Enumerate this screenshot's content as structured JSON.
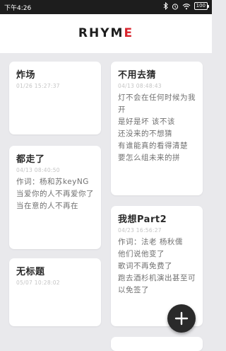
{
  "status_bar": {
    "time": "下午4:26",
    "battery": "100",
    "icons": [
      "bluetooth-icon",
      "alarm-icon",
      "wifi-icon",
      "battery-icon"
    ]
  },
  "app": {
    "title_main": "RHYM",
    "title_accent": "E",
    "accent_color": "#d9232d"
  },
  "notes": [
    {
      "title": "炸场",
      "time": "01/26 15:27:37",
      "body": ""
    },
    {
      "title": "不用去猜",
      "time": "04/13 08:48:43",
      "body": "灯不会在任何时候为我开\n是好是坏 该不该\n还没来的不想猜\n有谁能真的看得清楚\n要怎么组未来的拼"
    },
    {
      "title": "都走了",
      "time": "04/13 08:40:50",
      "body": "作词：杨和苏keyNG\n当爱你的人不再爱你了\n当在意的人不再在"
    },
    {
      "title": "我想Part2",
      "time": "04/23 16:56:27",
      "body": "作词：法老 杨秋儒\n他们说他变了\n歌词不再免费了\n跑去酒杉机演出甚至可以免签了"
    },
    {
      "title": "无标题",
      "time": "05/07 10:28:02",
      "body": ""
    }
  ],
  "fab": {
    "icon": "plus-icon"
  }
}
